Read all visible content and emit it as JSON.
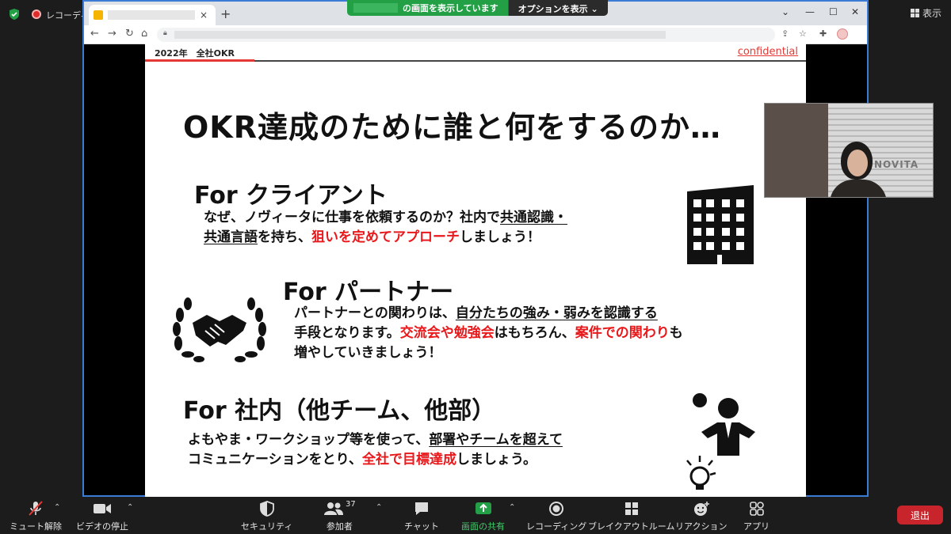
{
  "zoom_top": {
    "recording_label": "レコーディング",
    "view_label": "表示"
  },
  "share_banner": {
    "sharing_text": "の画面を表示しています",
    "options_label": "オプションを表示 ⌄"
  },
  "browser": {
    "tab_close": "×",
    "new_tab": "+",
    "win_min": "⌄",
    "win_restore": "—",
    "win_max": "☐",
    "win_close": "✕"
  },
  "slide": {
    "header_title": "2022年　全社OKR",
    "confidential": "confidential",
    "title": "OKR達成のために誰と何をするのか…",
    "client": {
      "heading": "For クライアント",
      "line1_a": "なぜ、ノヴィータに仕事を依頼するのか？社内で",
      "line1_u": "共通認識・",
      "line2_u": "共通言語",
      "line2_a": "を持ち、",
      "line2_red": "狙いを定めてアプローチ",
      "line2_b": "しましょう！"
    },
    "partner": {
      "heading": "For パートナー",
      "line1_a": "パートナーとの関わりは、",
      "line1_u": "自分たちの強み・弱みを認識する",
      "line2_a": "手段となります。",
      "line2_red1": "交流会や勉強会",
      "line2_b": "はもちろん、",
      "line2_red2": "案件での関わり",
      "line2_c": "も",
      "line3": "増やしていきましょう！"
    },
    "internal": {
      "heading": "For 社内（他チーム、他部）",
      "line1_a": "よもやま・ワークショップ等を使って、",
      "line1_u": "部署やチームを超えて",
      "line2_a": "コミュニケーションをとり、",
      "line2_red": "全社で目標達成",
      "line2_b": "しましょう。"
    }
  },
  "webcam": {
    "sign_text": "NOVITA"
  },
  "bottom_bar": {
    "mute": "ミュート解除",
    "video": "ビデオの停止",
    "security": "セキュリティ",
    "participants": "参加者",
    "participants_count": "37",
    "chat": "チャット",
    "share": "画面の共有",
    "record": "レコーディング",
    "breakout": "ブレイクアウトルーム",
    "reactions": "リアクション",
    "apps": "アプリ",
    "leave": "退出"
  },
  "colors": {
    "share_green": "#23a046",
    "slide_red": "#e8181b",
    "leave_red": "#c7252b",
    "browser_border": "#3a7bd5"
  }
}
